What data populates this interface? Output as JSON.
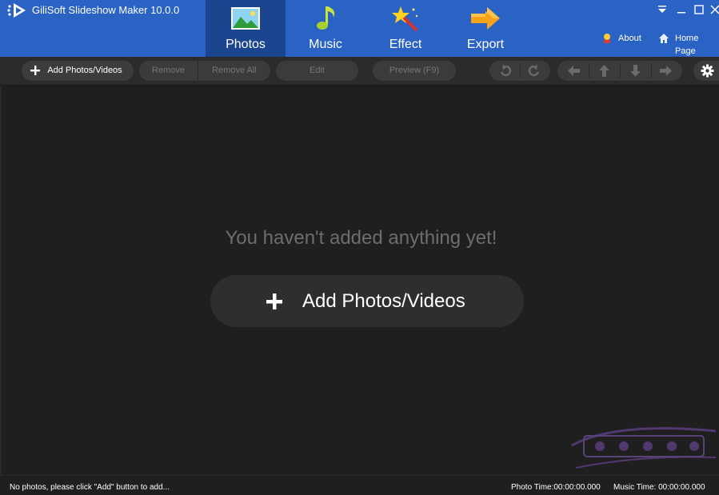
{
  "app": {
    "title": "GiliSoft Slideshow Maker 10.0.0"
  },
  "tabs": [
    {
      "label": "Photos",
      "icon": "photo-icon",
      "active": true
    },
    {
      "label": "Music",
      "icon": "music-note-icon",
      "active": false
    },
    {
      "label": "Effect",
      "icon": "magic-wand-icon",
      "active": false
    },
    {
      "label": "Export",
      "icon": "arrow-right-icon",
      "active": false
    }
  ],
  "header_links": {
    "about": "About",
    "home": "Home Page"
  },
  "toolbar": {
    "add": "Add Photos/Videos",
    "remove": "Remove",
    "remove_all": "Remove All",
    "edit": "Edit",
    "preview": "Preview (F9)"
  },
  "main": {
    "empty_message": "You haven't added anything yet!",
    "add_button": "Add Photos/Videos"
  },
  "status": {
    "left": "No photos, please click \"Add\" button to add...",
    "photo_time": "Photo Time:00:00:00.000",
    "music_time": "Music Time:  00:00:00.000"
  },
  "colors": {
    "header_bg": "#2a63c3",
    "active_tab_bg": "#1b468f",
    "toolbar_bg": "#2b2b2b",
    "main_bg": "#1f1f1f"
  }
}
